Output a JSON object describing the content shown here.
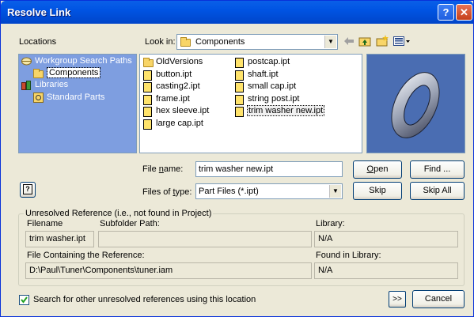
{
  "window": {
    "title": "Resolve Link",
    "help_glyph": "?",
    "close_glyph": "✕"
  },
  "locations": {
    "label": "Locations",
    "items": [
      {
        "label": "Workgroup Search Paths",
        "icon": "workgroup-icon"
      },
      {
        "label": "Components",
        "icon": "folder-icon",
        "selected": true
      },
      {
        "label": "Libraries",
        "icon": "libraries-icon"
      },
      {
        "label": "Standard Parts",
        "icon": "standard-parts-icon"
      }
    ]
  },
  "look_in": {
    "label": "Look in:",
    "value": "Components"
  },
  "files": {
    "column1": [
      {
        "name": "OldVersions",
        "type": "folder"
      },
      {
        "name": "button.ipt",
        "type": "file"
      },
      {
        "name": "casting2.ipt",
        "type": "file"
      },
      {
        "name": "frame.ipt",
        "type": "file"
      },
      {
        "name": "hex sleeve.ipt",
        "type": "file"
      },
      {
        "name": "large cap.ipt",
        "type": "file"
      }
    ],
    "column2": [
      {
        "name": "postcap.ipt",
        "type": "file"
      },
      {
        "name": "shaft.ipt",
        "type": "file"
      },
      {
        "name": "small cap.ipt",
        "type": "file"
      },
      {
        "name": "string post.ipt",
        "type": "file"
      },
      {
        "name": "trim washer  new.ipt",
        "type": "file",
        "selected": true
      }
    ]
  },
  "file_name": {
    "label": "File name:",
    "label_u": "n",
    "label_rest": "ame:",
    "label_pre": "File ",
    "value": "trim washer  new.ipt"
  },
  "file_type": {
    "label_pre": "Files of ",
    "label_u": "t",
    "label_rest": "ype:",
    "value": "Part Files (*.ipt)"
  },
  "buttons": {
    "open_u": "O",
    "open_rest": "pen",
    "find": "Find ...",
    "skip": "Skip",
    "skip_all": "Skip All",
    "cancel": "Cancel",
    "more": ">>"
  },
  "unresolved": {
    "legend": "Unresolved Reference (i.e., not found in Project)",
    "filename_label": "Filename",
    "filename_value": "trim washer.ipt",
    "subfolder_label": "Subfolder Path:",
    "subfolder_value": "",
    "library_label": "Library:",
    "library_value": "N/A",
    "containing_label": "File Containing the Reference:",
    "containing_value": "D:\\Paul\\Tuner\\Components\\tuner.iam",
    "found_label": "Found in Library:",
    "found_value": "N/A"
  },
  "search_option": {
    "label": "Search for other unresolved references using this location",
    "checked": true
  },
  "colors": {
    "title_bar": "#0054e3",
    "dialog_bg": "#ece9d8",
    "locations_bg": "#7e9ee0",
    "preview_bg": "#4a6db2"
  }
}
